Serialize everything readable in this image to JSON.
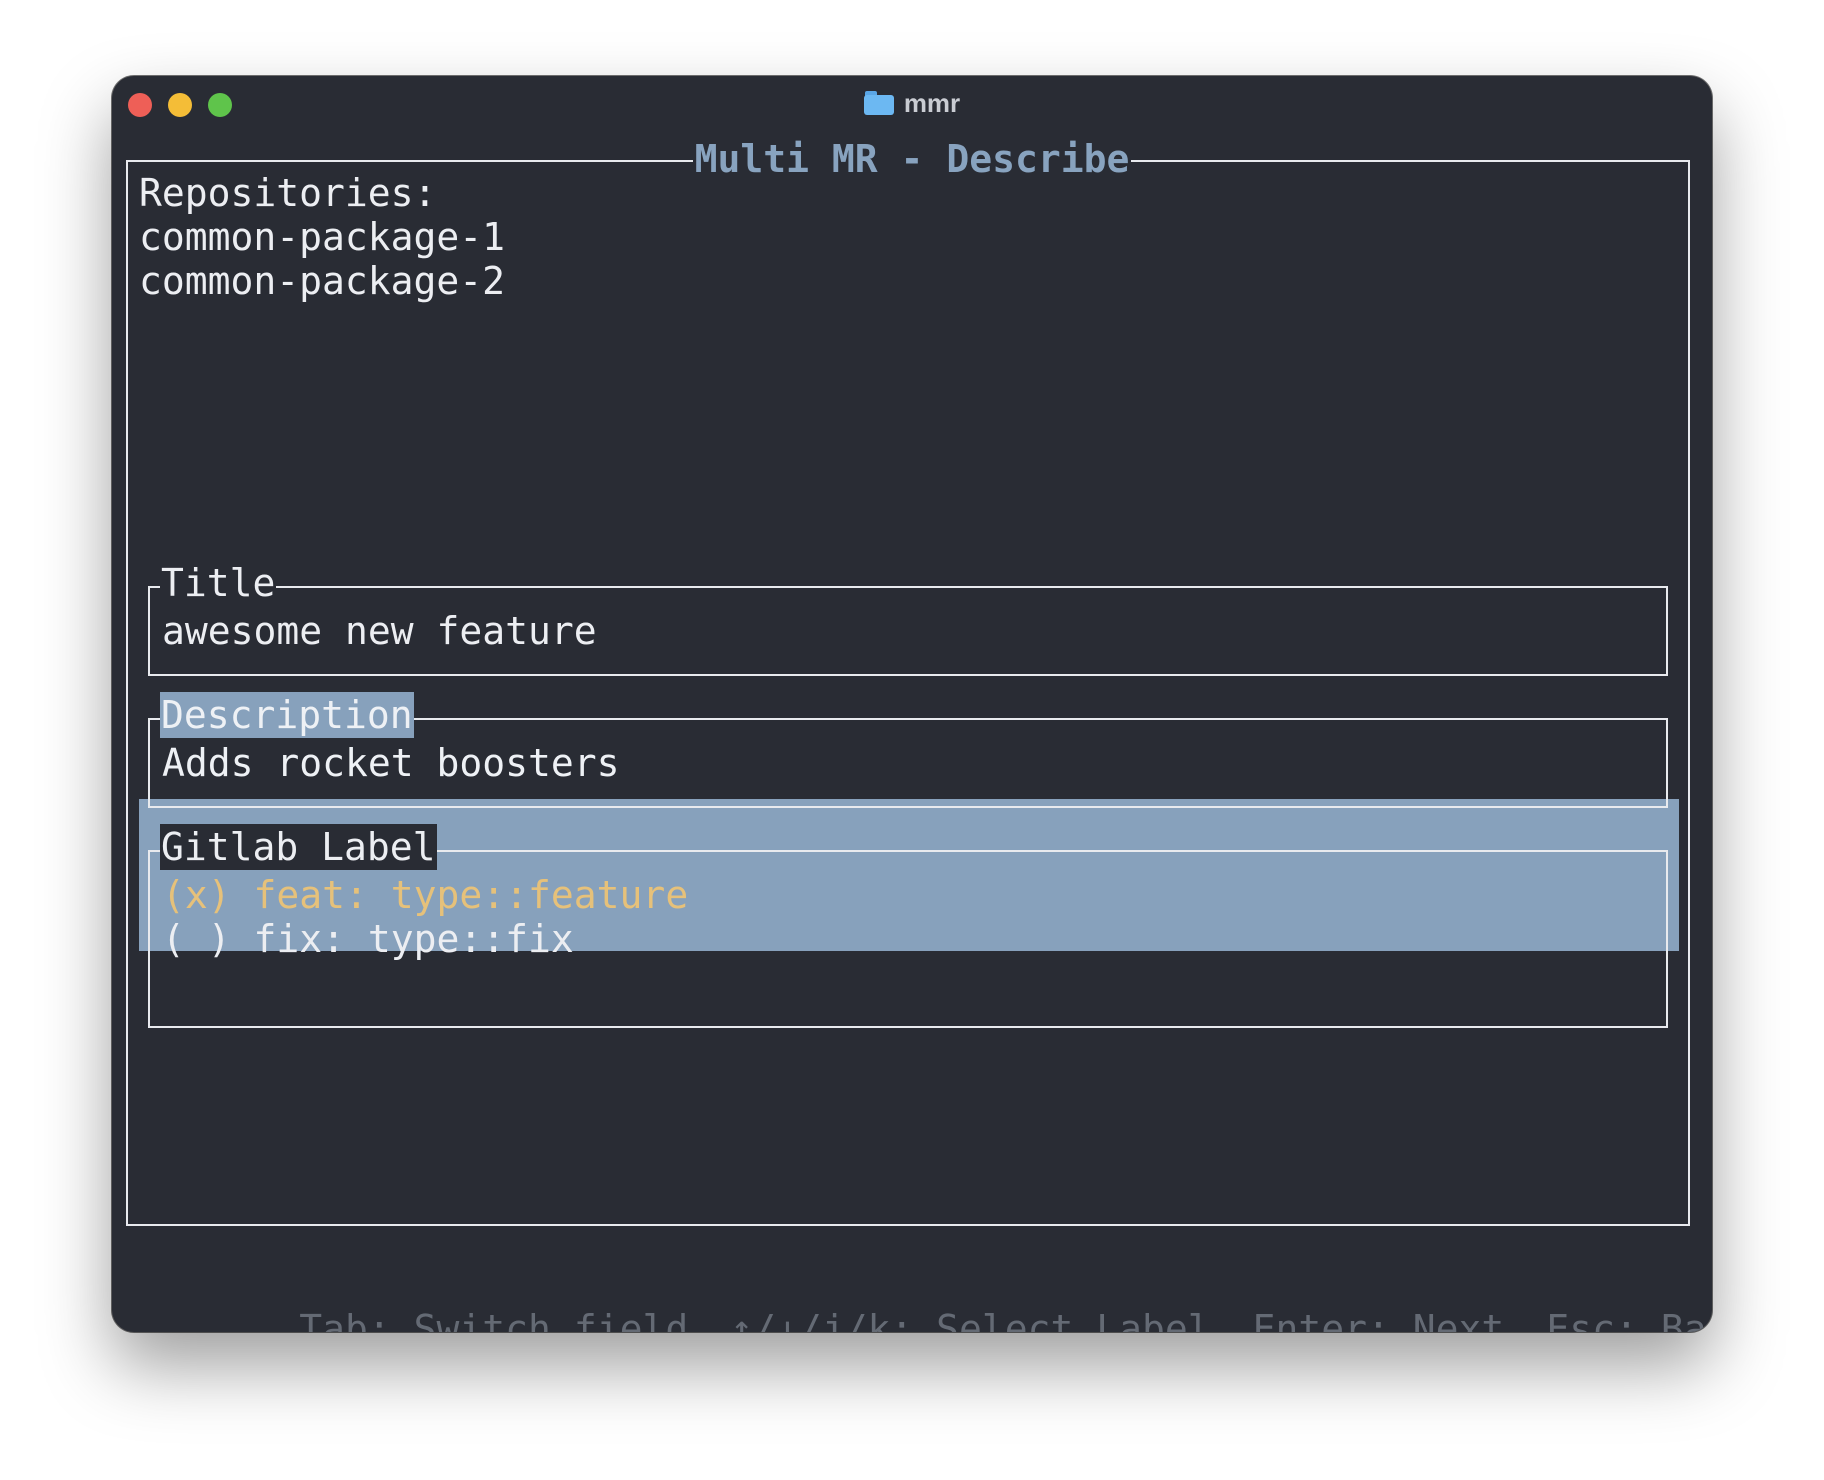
{
  "window": {
    "app_name": "mmr",
    "icon": "folder-icon"
  },
  "screen": {
    "title": "Multi MR - Describe"
  },
  "repositories": {
    "heading": "Repositories:",
    "items": [
      "common-package-1",
      "common-package-2"
    ]
  },
  "fields": {
    "title": {
      "label": "Title",
      "value": "awesome new feature"
    },
    "description": {
      "label": "Description",
      "value": "Adds rocket boosters",
      "focused": true
    },
    "gitlab_label": {
      "label": "Gitlab Label",
      "options": [
        {
          "text": "(x) feat: type::feature",
          "selected": true
        },
        {
          "text": "( ) fix: type::fix",
          "selected": false
        }
      ]
    }
  },
  "footer": {
    "hints": [
      "Tab: Switch field",
      "↑/↓/j/k: Select Label",
      "Enter: Next",
      "Esc: Back"
    ]
  },
  "colors": {
    "background": "#292c34",
    "accent_title": "#88a3bf",
    "focus_highlight": "#87a1bc",
    "selected_option": "#e6c17a",
    "footer_text": "#646a74"
  }
}
